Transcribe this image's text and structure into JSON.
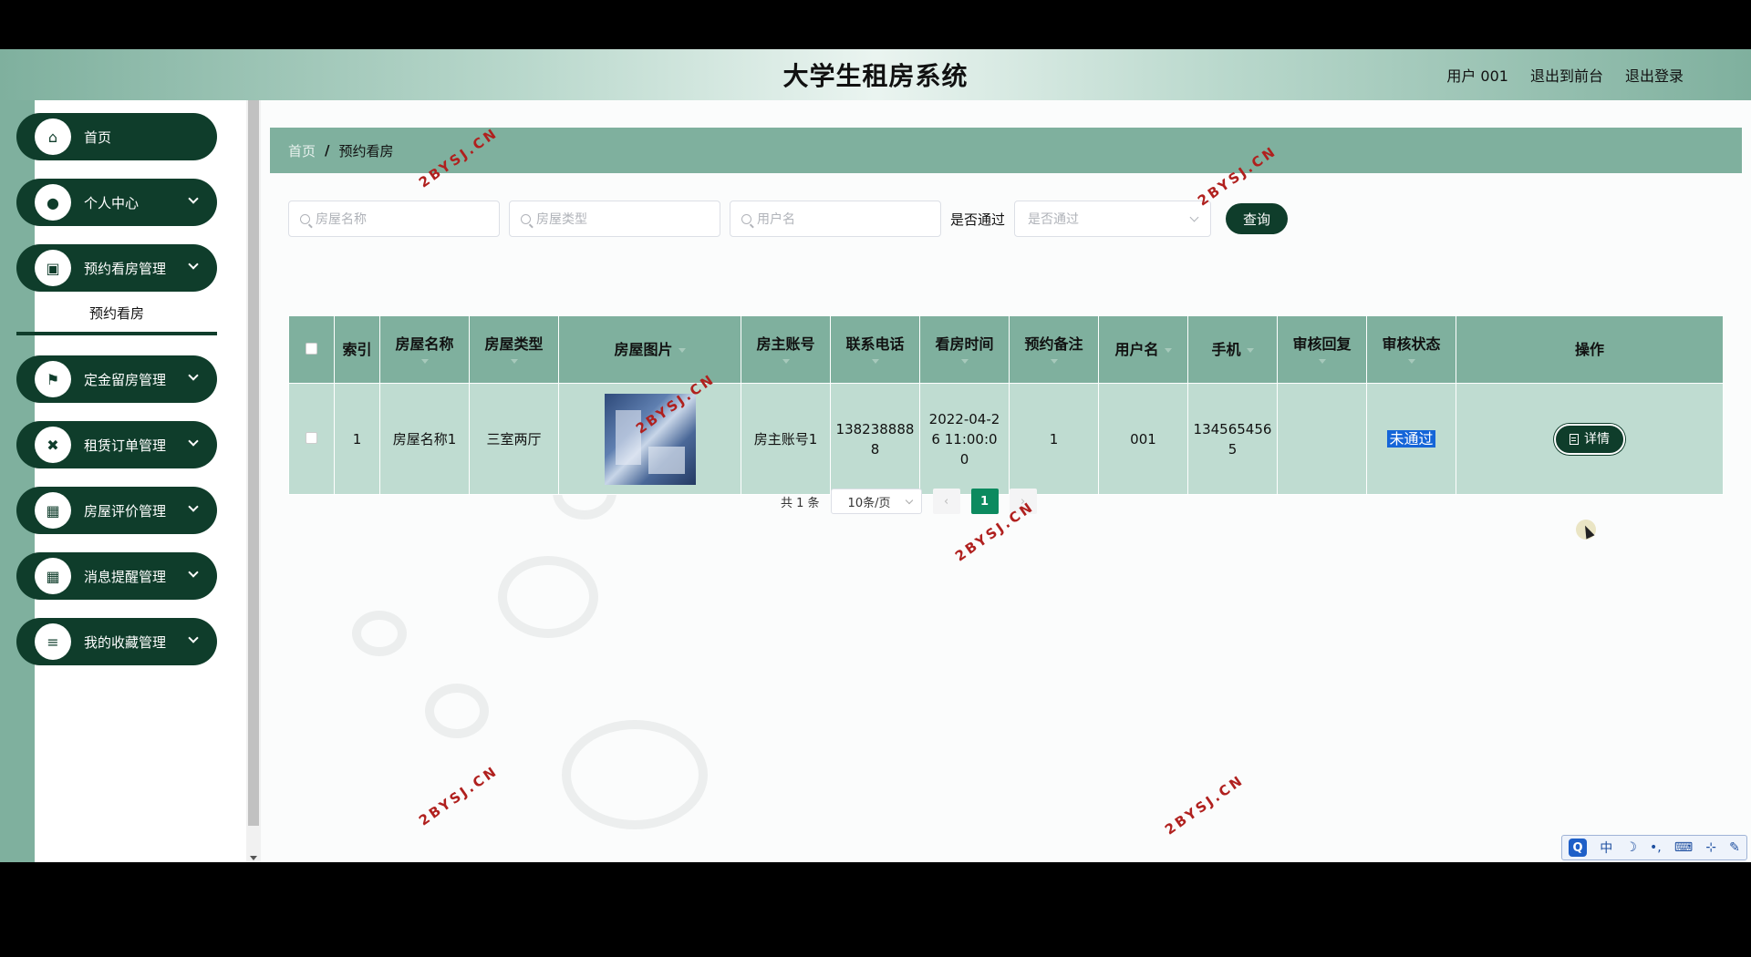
{
  "header": {
    "title": "大学生租房系统",
    "user": "用户 001",
    "back_to_front": "退出到前台",
    "logout": "退出登录"
  },
  "sidebar": {
    "items": [
      {
        "label": "首页",
        "icon": "home-icon",
        "expandable": false
      },
      {
        "label": "个人中心",
        "icon": "user-icon",
        "expandable": true
      },
      {
        "label": "预约看房管理",
        "icon": "clipboard-icon",
        "expandable": true
      },
      {
        "label": "定金留房管理",
        "icon": "flag-icon",
        "expandable": true
      },
      {
        "label": "租赁订单管理",
        "icon": "ticket-icon",
        "expandable": true
      },
      {
        "label": "房屋评价管理",
        "icon": "grid-icon",
        "expandable": true
      },
      {
        "label": "消息提醒管理",
        "icon": "grid-icon",
        "expandable": true
      },
      {
        "label": "我的收藏管理",
        "icon": "list-icon",
        "expandable": true
      }
    ],
    "active_sub": "预约看房"
  },
  "breadcrumb": {
    "home": "首页",
    "current": "预约看房"
  },
  "search": {
    "house_name_placeholder": "房屋名称",
    "house_type_placeholder": "房屋类型",
    "username_placeholder": "用户名",
    "passed_label": "是否通过",
    "passed_placeholder": "是否通过",
    "query_button": "查询"
  },
  "table": {
    "columns": [
      "索引",
      "房屋名称",
      "房屋类型",
      "房屋图片",
      "房主账号",
      "联系电话",
      "看房时间",
      "预约备注",
      "用户名",
      "手机",
      "审核回复",
      "审核状态",
      "操作"
    ],
    "rows": [
      {
        "index": "1",
        "house_name": "房屋名称1",
        "house_type": "三室两厅",
        "owner_account": "房主账号1",
        "phone_a": "138238888",
        "phone_b": "8",
        "view_time_a": "2022-04-2",
        "view_time_b": "6 11:00:0",
        "view_time_c": "0",
        "note": "1",
        "username": "001",
        "mobile_a": "134565456",
        "mobile_b": "5",
        "review_reply": "",
        "review_status": "未通过",
        "action": "详情"
      }
    ]
  },
  "pager": {
    "total": "共 1 条",
    "page_size": "10条/页",
    "current_page": "1"
  },
  "watermark": "2BYSJ.CN",
  "ime": {
    "mode": "中"
  },
  "colors": {
    "accent": "#7fb09e",
    "dark": "#0f3d2b",
    "row": "#bfdcd1",
    "active_page": "#0c8a5f"
  }
}
